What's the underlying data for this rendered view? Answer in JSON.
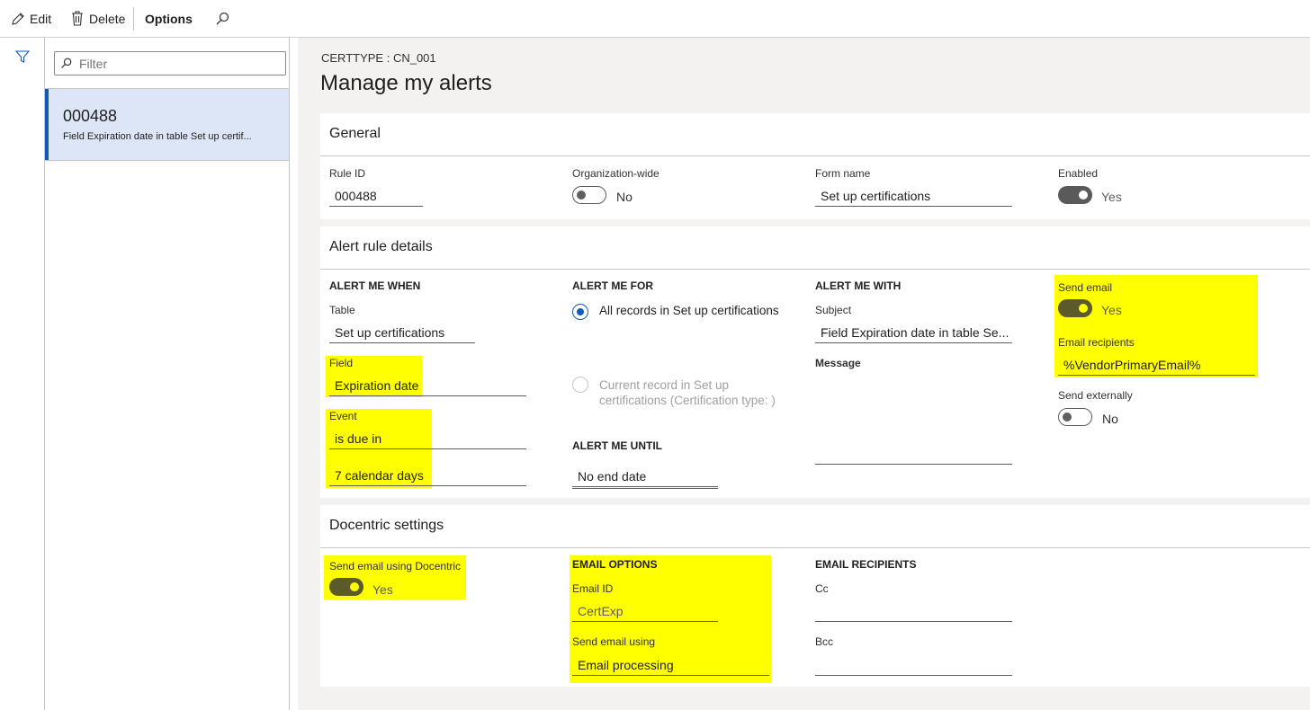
{
  "toolbar": {
    "edit_label": "Edit",
    "delete_label": "Delete",
    "options_label": "Options"
  },
  "list": {
    "filter_placeholder": "Filter",
    "items": [
      {
        "title": "000488",
        "subtitle": "Field Expiration date in table Set up certif..."
      }
    ]
  },
  "header": {
    "breadcrumb": "CERTTYPE : CN_001",
    "title": "Manage my alerts"
  },
  "general": {
    "title": "General",
    "rule_id_label": "Rule ID",
    "rule_id_value": "000488",
    "org_wide_label": "Organization-wide",
    "org_wide_value": "No",
    "form_name_label": "Form name",
    "form_name_value": "Set up certifications",
    "enabled_label": "Enabled",
    "enabled_value": "Yes"
  },
  "alert_rule": {
    "title": "Alert rule details",
    "when": {
      "heading": "ALERT ME WHEN",
      "table_label": "Table",
      "table_value": "Set up certifications",
      "field_label": "Field",
      "field_value": "Expiration date",
      "event_label": "Event",
      "event_value": "is due in",
      "event_days": "7 calendar days"
    },
    "for": {
      "heading": "ALERT ME FOR",
      "option_all": "All records in Set up certifications",
      "option_current_line1": "Current record in Set up",
      "option_current_line2": "certifications (Certification type: )"
    },
    "until": {
      "heading": "ALERT ME UNTIL",
      "value": "No end date"
    },
    "with": {
      "heading": "ALERT ME WITH",
      "subject_label": "Subject",
      "subject_value": "Field Expiration date in table Se...",
      "message_label": "Message"
    },
    "send_email_label": "Send email",
    "send_email_value": "Yes",
    "email_recipients_label": "Email recipients",
    "email_recipients_value": "%VendorPrimaryEmail%",
    "send_externally_label": "Send externally",
    "send_externally_value": "No"
  },
  "docentric": {
    "title": "Docentric settings",
    "send_using_docentric_label": "Send email using Docentric",
    "send_using_docentric_value": "Yes",
    "email_options_heading": "EMAIL OPTIONS",
    "email_id_label": "Email ID",
    "email_id_value": "CertExp",
    "send_email_using_label": "Send email using",
    "send_email_using_value": "Email processing",
    "email_recipients_heading": "EMAIL RECIPIENTS",
    "cc_label": "Cc",
    "bcc_label": "Bcc"
  },
  "colors": {
    "highlight": "#ffff00",
    "accent": "#0f5bb5",
    "list_selected": "#dce6f7"
  }
}
